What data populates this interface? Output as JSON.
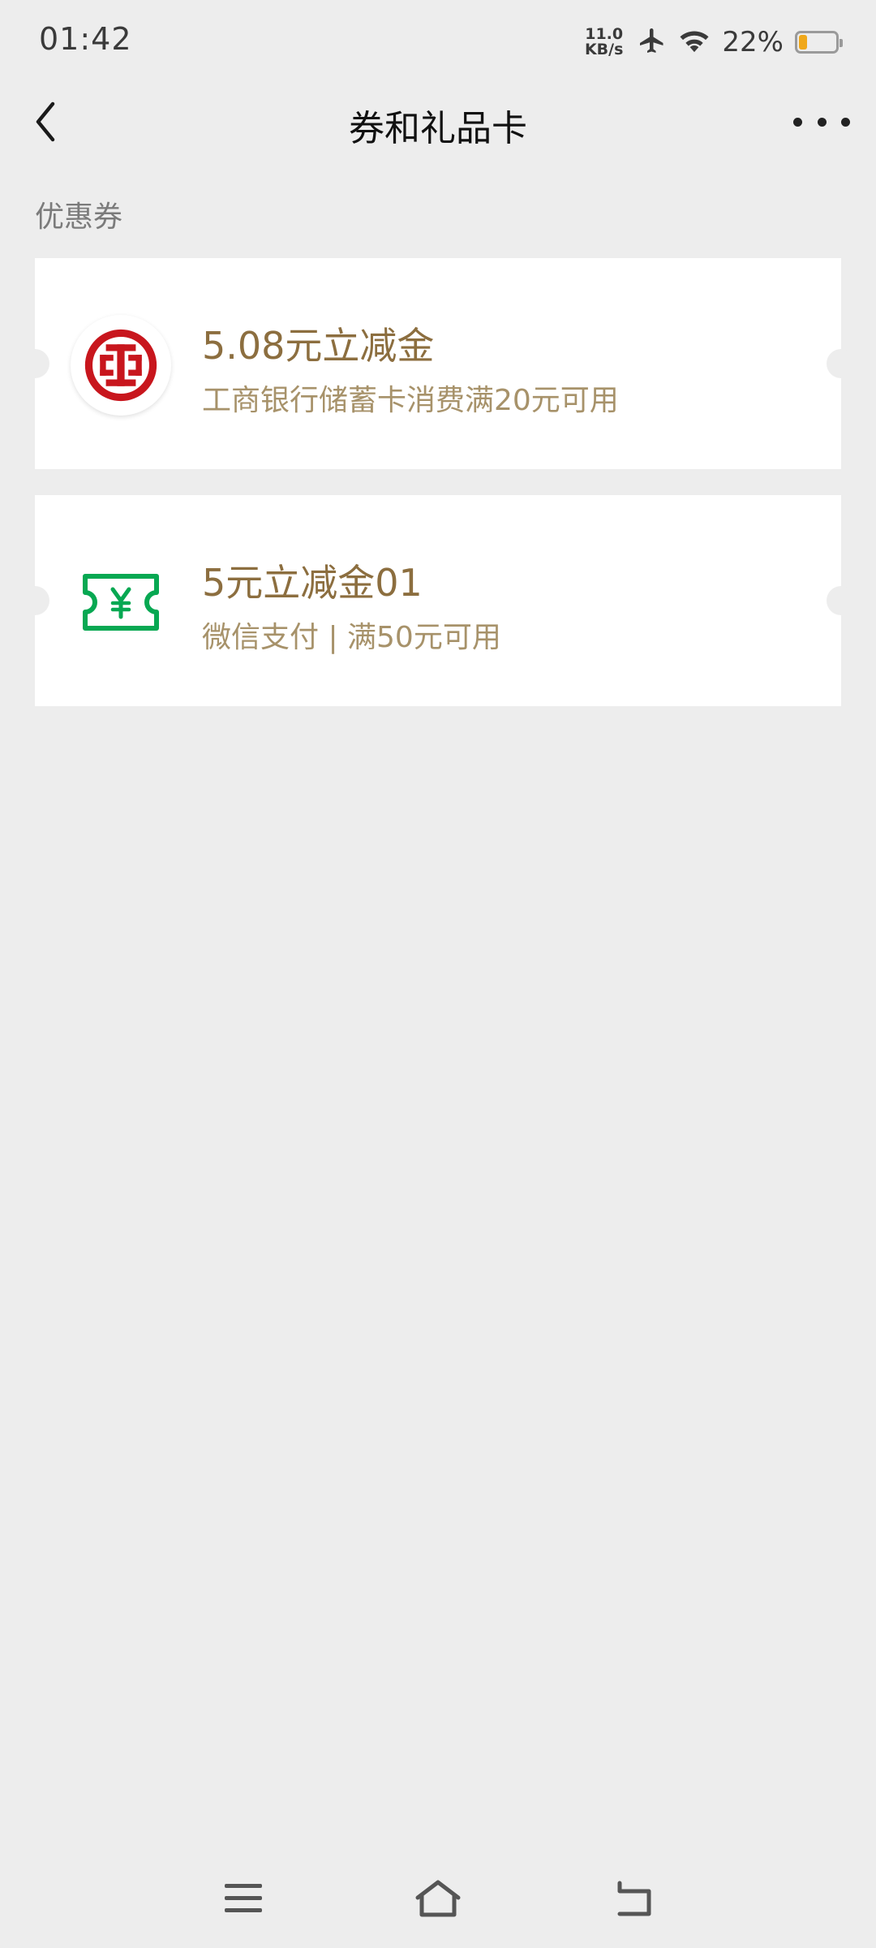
{
  "status_bar": {
    "time": "01:42",
    "net_speed_value": "11.0",
    "net_speed_unit": "KB/s",
    "battery_percent": "22%",
    "battery_level": 0.22
  },
  "nav": {
    "title": "券和礼品卡"
  },
  "section": {
    "label": "优惠券"
  },
  "coupons": [
    {
      "title": "5.08元立减金",
      "desc": "工商银行储蓄卡消费满20元可用",
      "icon": "icbc-logo-icon"
    },
    {
      "title": "5元立减金01",
      "desc": "微信支付 | 满50元可用",
      "icon": "yuan-ticket-icon"
    }
  ],
  "colors": {
    "background": "#ededed",
    "coupon_title": "#8c6e3f",
    "coupon_desc": "#a7926a",
    "icbc_red": "#c8161d",
    "wechat_green": "#07a852"
  }
}
